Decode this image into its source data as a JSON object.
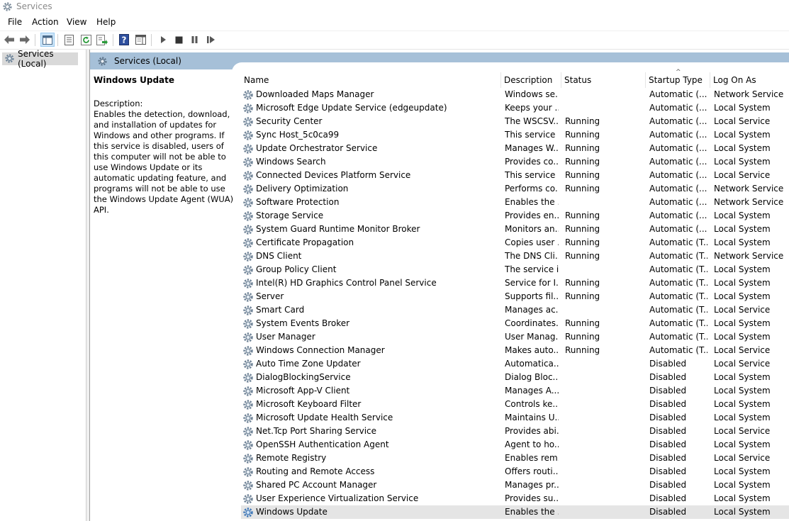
{
  "window": {
    "title": "Services"
  },
  "menu": [
    "File",
    "Action",
    "View",
    "Help"
  ],
  "tree": {
    "root": "Services (Local)"
  },
  "header": {
    "title": "Services (Local)"
  },
  "detail": {
    "service_name": "Windows Update",
    "description_label": "Description:",
    "description": "Enables the detection, download, and installation of updates for Windows and other programs. If this service is disabled, users of this computer will not be able to use Windows Update or its automatic updating feature, and programs will not be able to use the Windows Update Agent (WUA) API."
  },
  "columns": {
    "name": "Name",
    "description": "Description",
    "status": "Status",
    "startup": "Startup Type",
    "logon": "Log On As",
    "sort_indicator": "^"
  },
  "services": [
    {
      "name": "Downloaded Maps Manager",
      "description": "Windows se...",
      "status": "",
      "startup": "Automatic (...",
      "logon": "Network Service"
    },
    {
      "name": "Microsoft Edge Update Service (edgeupdate)",
      "description": "Keeps your ...",
      "status": "",
      "startup": "Automatic (...",
      "logon": "Local System"
    },
    {
      "name": "Security Center",
      "description": "The WSCSV...",
      "status": "Running",
      "startup": "Automatic (...",
      "logon": "Local Service"
    },
    {
      "name": "Sync Host_5c0ca99",
      "description": "This service ...",
      "status": "Running",
      "startup": "Automatic (...",
      "logon": "Local System"
    },
    {
      "name": "Update Orchestrator Service",
      "description": "Manages W...",
      "status": "Running",
      "startup": "Automatic (...",
      "logon": "Local System"
    },
    {
      "name": "Windows Search",
      "description": "Provides co...",
      "status": "Running",
      "startup": "Automatic (...",
      "logon": "Local System"
    },
    {
      "name": "Connected Devices Platform Service",
      "description": "This service ...",
      "status": "Running",
      "startup": "Automatic (...",
      "logon": "Local Service"
    },
    {
      "name": "Delivery Optimization",
      "description": "Performs co...",
      "status": "Running",
      "startup": "Automatic (...",
      "logon": "Network Service"
    },
    {
      "name": "Software Protection",
      "description": "Enables the ...",
      "status": "",
      "startup": "Automatic (...",
      "logon": "Network Service"
    },
    {
      "name": "Storage Service",
      "description": "Provides en...",
      "status": "Running",
      "startup": "Automatic (...",
      "logon": "Local System"
    },
    {
      "name": "System Guard Runtime Monitor Broker",
      "description": "Monitors an...",
      "status": "Running",
      "startup": "Automatic (...",
      "logon": "Local System"
    },
    {
      "name": "Certificate Propagation",
      "description": "Copies user ...",
      "status": "Running",
      "startup": "Automatic (T...",
      "logon": "Local System"
    },
    {
      "name": "DNS Client",
      "description": "The DNS Cli...",
      "status": "Running",
      "startup": "Automatic (T...",
      "logon": "Network Service"
    },
    {
      "name": "Group Policy Client",
      "description": "The service i...",
      "status": "",
      "startup": "Automatic (T...",
      "logon": "Local System"
    },
    {
      "name": "Intel(R) HD Graphics Control Panel Service",
      "description": "Service for I...",
      "status": "Running",
      "startup": "Automatic (T...",
      "logon": "Local System"
    },
    {
      "name": "Server",
      "description": "Supports fil...",
      "status": "Running",
      "startup": "Automatic (T...",
      "logon": "Local System"
    },
    {
      "name": "Smart Card",
      "description": "Manages ac...",
      "status": "",
      "startup": "Automatic (T...",
      "logon": "Local Service"
    },
    {
      "name": "System Events Broker",
      "description": "Coordinates...",
      "status": "Running",
      "startup": "Automatic (T...",
      "logon": "Local System"
    },
    {
      "name": "User Manager",
      "description": "User Manag...",
      "status": "Running",
      "startup": "Automatic (T...",
      "logon": "Local System"
    },
    {
      "name": "Windows Connection Manager",
      "description": "Makes auto...",
      "status": "Running",
      "startup": "Automatic (T...",
      "logon": "Local Service"
    },
    {
      "name": "Auto Time Zone Updater",
      "description": "Automatica...",
      "status": "",
      "startup": "Disabled",
      "logon": "Local Service"
    },
    {
      "name": "DialogBlockingService",
      "description": "Dialog Bloc...",
      "status": "",
      "startup": "Disabled",
      "logon": "Local System"
    },
    {
      "name": "Microsoft App-V Client",
      "description": "Manages A...",
      "status": "",
      "startup": "Disabled",
      "logon": "Local System"
    },
    {
      "name": "Microsoft Keyboard Filter",
      "description": "Controls ke...",
      "status": "",
      "startup": "Disabled",
      "logon": "Local System"
    },
    {
      "name": "Microsoft Update Health Service",
      "description": "Maintains U...",
      "status": "",
      "startup": "Disabled",
      "logon": "Local System"
    },
    {
      "name": "Net.Tcp Port Sharing Service",
      "description": "Provides abi...",
      "status": "",
      "startup": "Disabled",
      "logon": "Local Service"
    },
    {
      "name": "OpenSSH Authentication Agent",
      "description": "Agent to ho...",
      "status": "",
      "startup": "Disabled",
      "logon": "Local System"
    },
    {
      "name": "Remote Registry",
      "description": "Enables rem...",
      "status": "",
      "startup": "Disabled",
      "logon": "Local Service"
    },
    {
      "name": "Routing and Remote Access",
      "description": "Offers routi...",
      "status": "",
      "startup": "Disabled",
      "logon": "Local System"
    },
    {
      "name": "Shared PC Account Manager",
      "description": "Manages pr...",
      "status": "",
      "startup": "Disabled",
      "logon": "Local System"
    },
    {
      "name": "User Experience Virtualization Service",
      "description": "Provides su...",
      "status": "",
      "startup": "Disabled",
      "logon": "Local System"
    },
    {
      "name": "Windows Update",
      "description": "Enables the ...",
      "status": "",
      "startup": "Disabled",
      "logon": "Local System",
      "selected": true
    }
  ]
}
